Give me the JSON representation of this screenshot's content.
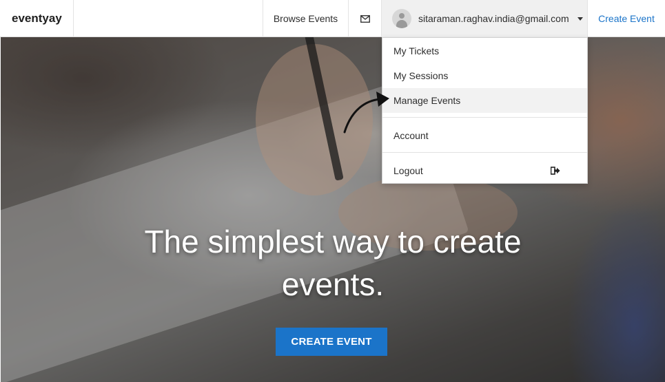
{
  "brand": "eventyay",
  "nav": {
    "browse_label": "Browse Events",
    "mail_icon": "envelope-icon",
    "user_email": "sitaraman.raghav.india@gmail.com",
    "create_label": "Create Event"
  },
  "dropdown": {
    "items": [
      {
        "label": "My Tickets"
      },
      {
        "label": "My Sessions"
      },
      {
        "label": "Manage Events",
        "highlighted": true
      },
      {
        "label": "Account"
      },
      {
        "label": "Logout",
        "icon": "sign-out-icon"
      }
    ]
  },
  "hero": {
    "tagline": "The simplest way to create events.",
    "cta_label": "CREATE EVENT"
  },
  "colors": {
    "accent": "#1b74c9",
    "user_bg": "#f0f0f0",
    "highlight_bg": "#f2f2f2"
  }
}
